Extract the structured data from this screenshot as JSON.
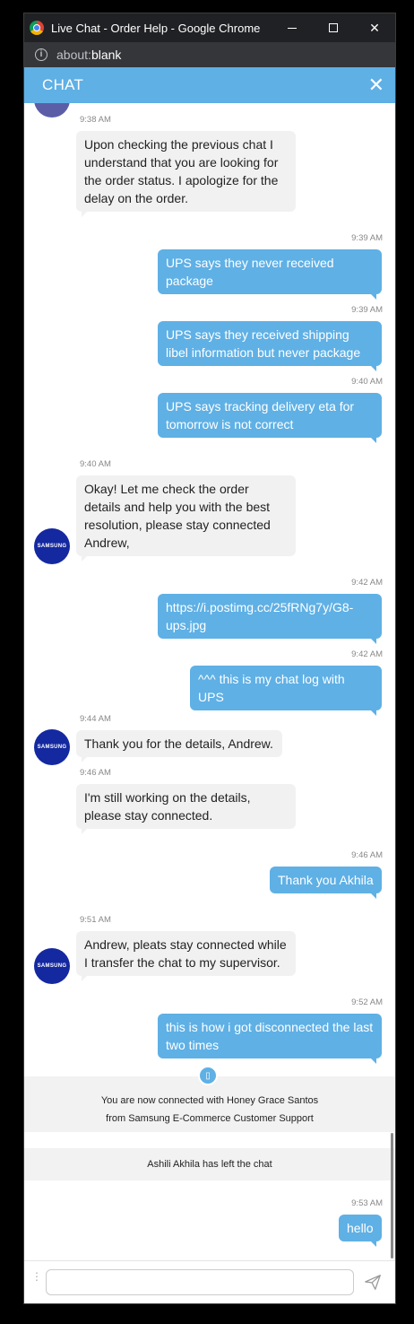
{
  "window": {
    "title": "Live Chat - Order Help - Google Chrome",
    "url_prefix": "about:",
    "url_host": "blank"
  },
  "chat": {
    "header_title": "CHAT",
    "avatar_label": "SAMSUNG",
    "system_icon": "▯",
    "input_placeholder": ""
  },
  "messages": [
    {
      "time": "9:38 AM",
      "text": "Upon checking the previous chat I understand that you are looking for the order status. I apologize for the delay on the order."
    },
    {
      "time": "9:39 AM",
      "text": "UPS says they never received package"
    },
    {
      "time": "9:39 AM",
      "text": "UPS says they received shipping libel information but never package"
    },
    {
      "time": "9:40 AM",
      "text": "UPS says tracking delivery eta for tomorrow is not correct"
    },
    {
      "time": "9:40 AM",
      "text": "Okay! Let me check the order details and help you with the best resolution, please stay connected Andrew,"
    },
    {
      "time": "9:42 AM",
      "text": "https://i.postimg.cc/25fRNg7y/G8-ups.jpg"
    },
    {
      "time": "9:42 AM",
      "text": "^^^ this is my chat log with UPS"
    },
    {
      "time": "9:44 AM",
      "text": "Thank you for the details, Andrew."
    },
    {
      "time": "9:46 AM",
      "text": "I'm still working on the details, please stay connected."
    },
    {
      "time": "9:46 AM",
      "text": "Thank you Akhila"
    },
    {
      "time": "9:51 AM",
      "text": "Andrew, pleats stay connected while I transfer the chat to my supervisor."
    },
    {
      "time": "9:52 AM",
      "text": "this is how i got disconnected the last two times"
    },
    {
      "time": "9:53 AM",
      "text": "hello"
    }
  ],
  "system": {
    "connected_line1": "You are now connected with Honey Grace Santos",
    "connected_line2": "from Samsung E-Commerce Customer Support",
    "left": "Ashili Akhila has left the chat"
  }
}
